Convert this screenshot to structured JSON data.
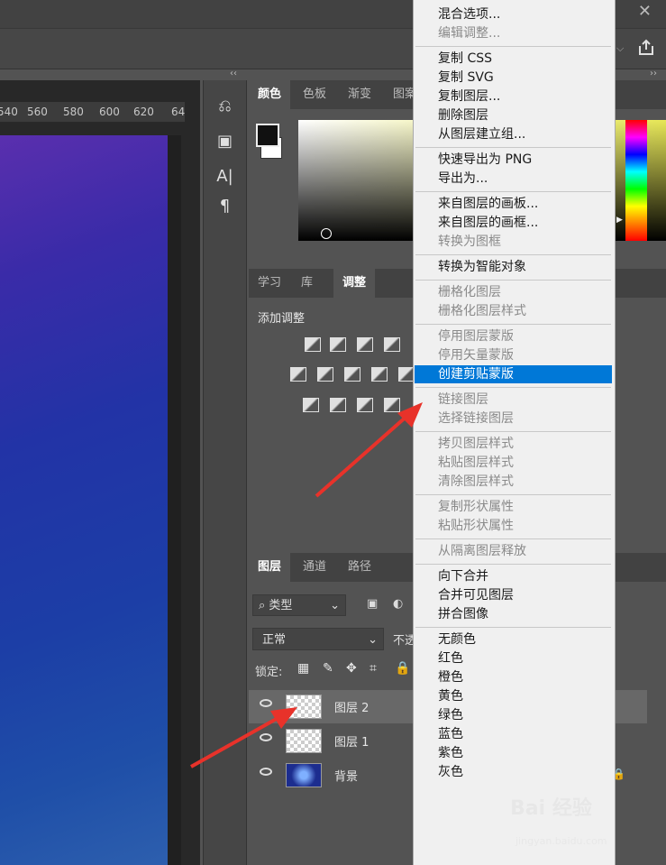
{
  "window": {
    "close_symbol": "✕"
  },
  "ruler": {
    "ticks": [
      "540",
      "560",
      "580",
      "600",
      "620",
      "64"
    ]
  },
  "color_panel": {
    "tabs": [
      "颜色",
      "色板",
      "渐变",
      "图案"
    ]
  },
  "adjust_panel": {
    "tabs": [
      "学习",
      "库",
      "调整"
    ],
    "title": "添加调整"
  },
  "layers_panel": {
    "tabs": [
      "图层",
      "通道",
      "路径"
    ],
    "filter_label": "类型",
    "blend_mode": "正常",
    "opacity_label": "不透",
    "lock_label": "锁定:",
    "layers": [
      {
        "name": "图层 2",
        "selected": true
      },
      {
        "name": "图层 1",
        "selected": false
      },
      {
        "name": "背景",
        "selected": false,
        "locked": true
      }
    ]
  },
  "context_menu": {
    "items": [
      {
        "label": "混合选项...",
        "disabled": false
      },
      {
        "label": "编辑调整...",
        "disabled": true
      },
      {
        "sep": true
      },
      {
        "label": "复制 CSS",
        "disabled": false
      },
      {
        "label": "复制 SVG",
        "disabled": false
      },
      {
        "label": "复制图层...",
        "disabled": false
      },
      {
        "label": "删除图层",
        "disabled": false
      },
      {
        "label": "从图层建立组...",
        "disabled": false
      },
      {
        "sep": true
      },
      {
        "label": "快速导出为 PNG",
        "disabled": false
      },
      {
        "label": "导出为...",
        "disabled": false
      },
      {
        "sep": true
      },
      {
        "label": "来自图层的画板...",
        "disabled": false
      },
      {
        "label": "来自图层的画框...",
        "disabled": false
      },
      {
        "label": "转换为图框",
        "disabled": true
      },
      {
        "sep": true
      },
      {
        "label": "转换为智能对象",
        "disabled": false
      },
      {
        "sep": true
      },
      {
        "label": "栅格化图层",
        "disabled": true
      },
      {
        "label": "栅格化图层样式",
        "disabled": true
      },
      {
        "sep": true
      },
      {
        "label": "停用图层蒙版",
        "disabled": true
      },
      {
        "label": "停用矢量蒙版",
        "disabled": true
      },
      {
        "label": "创建剪贴蒙版",
        "disabled": false,
        "highlighted": true
      },
      {
        "sep": true
      },
      {
        "label": "链接图层",
        "disabled": true
      },
      {
        "label": "选择链接图层",
        "disabled": true
      },
      {
        "sep": true
      },
      {
        "label": "拷贝图层样式",
        "disabled": true
      },
      {
        "label": "粘贴图层样式",
        "disabled": true
      },
      {
        "label": "清除图层样式",
        "disabled": true
      },
      {
        "sep": true
      },
      {
        "label": "复制形状属性",
        "disabled": true
      },
      {
        "label": "粘贴形状属性",
        "disabled": true
      },
      {
        "sep": true
      },
      {
        "label": "从隔离图层释放",
        "disabled": true
      },
      {
        "sep": true
      },
      {
        "label": "向下合并",
        "disabled": false
      },
      {
        "label": "合并可见图层",
        "disabled": false
      },
      {
        "label": "拼合图像",
        "disabled": false
      },
      {
        "sep": true
      },
      {
        "label": "无颜色",
        "disabled": false
      },
      {
        "label": "红色",
        "disabled": false
      },
      {
        "label": "橙色",
        "disabled": false
      },
      {
        "label": "黄色",
        "disabled": false
      },
      {
        "label": "绿色",
        "disabled": false
      },
      {
        "label": "蓝色",
        "disabled": false
      },
      {
        "label": "紫色",
        "disabled": false
      },
      {
        "label": "灰色",
        "disabled": false
      }
    ]
  },
  "watermark": {
    "text": "Bai 经验",
    "url": "jingyan.baidu.com"
  },
  "colors": {
    "highlight": "#0078d7",
    "arrow": "#e8322a"
  }
}
